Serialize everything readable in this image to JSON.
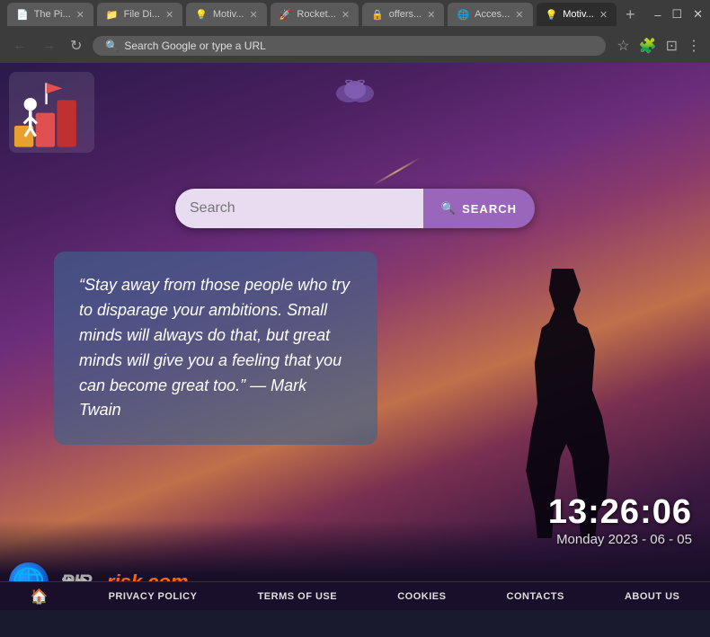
{
  "browser": {
    "tabs": [
      {
        "label": "The Pi...",
        "active": false,
        "favicon": "📄"
      },
      {
        "label": "File Di...",
        "active": false,
        "favicon": "📁"
      },
      {
        "label": "Motiv...",
        "active": false,
        "favicon": "💡"
      },
      {
        "label": "Rocket...",
        "active": false,
        "favicon": "🚀"
      },
      {
        "label": "offers...",
        "active": false,
        "favicon": "🔒"
      },
      {
        "label": "Acces...",
        "active": false,
        "favicon": "🌐"
      },
      {
        "label": "Motiv...",
        "active": true,
        "favicon": "💡"
      }
    ],
    "address": "Search Google or type a URL",
    "window_controls": [
      "–",
      "☐",
      "✕"
    ]
  },
  "page": {
    "cloud_icon": "☁",
    "search_placeholder": "Search",
    "search_button": "SEARCH",
    "quote": "“Stay away from those people who try to disparage your ambitions. Small minds will always do that, but great minds will give you a feeling that you can become great too.” — Mark Twain",
    "clock": {
      "time": "13:26:06",
      "date": "Monday 2023 - 06 - 05"
    },
    "brand": {
      "text_grey": "⌁⌁",
      "text_full": "risk.com"
    },
    "footer": {
      "home_icon": "🏠",
      "links": [
        "PRIVACY POLICY",
        "TERMS OF USE",
        "COOKIES",
        "CONTACTS",
        "ABOUT US"
      ]
    }
  }
}
